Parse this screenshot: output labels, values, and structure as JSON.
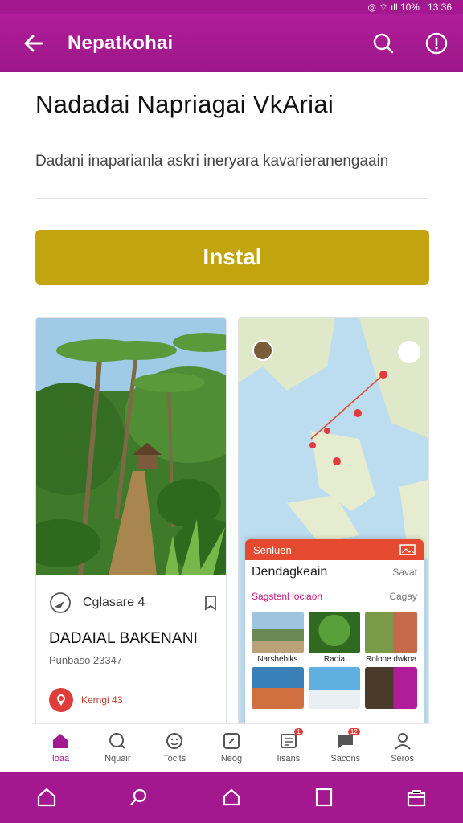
{
  "status_bar": {
    "indicators": "◎ ⌔ ıll 10%",
    "time": "13:36"
  },
  "app_bar": {
    "title": "Nepatkohai",
    "icons": [
      "back-arrow-icon",
      "search-icon",
      "more-info-icon"
    ]
  },
  "app": {
    "title": "Nadadai Napriagai VkAriai",
    "description": "Dadani inaparianla askri ineryara kavarieranengaain",
    "install_label": "Instal"
  },
  "card_left": {
    "info_label": "Cglasare 4",
    "heading": "DADAIAL BAKENANI",
    "sub": "Punbaso 23347",
    "pin_text": "Kerngi 43"
  },
  "card_right": {
    "sheet_header": "Senluen",
    "sheet_title": "Dendagkeain",
    "sheet_meta_1": "Savat",
    "accent_label": "Sagstenl lociaon",
    "sheet_meta_2": "Cagay",
    "thumb_captions": [
      "Narshebiks",
      "Raoia",
      "Rolone dwkoa"
    ]
  },
  "bottom_tabs": [
    {
      "label": "Ioaa",
      "icon": "home-icon",
      "active": true
    },
    {
      "label": "Nquair",
      "icon": "search-icon"
    },
    {
      "label": "Tocits",
      "icon": "face-icon"
    },
    {
      "label": "Neog",
      "icon": "edit-icon"
    },
    {
      "label": "Iisans",
      "icon": "list-icon",
      "badge": "1"
    },
    {
      "label": "Sacons",
      "icon": "chat-icon",
      "badge": "12"
    },
    {
      "label": "Seros",
      "icon": "profile-icon"
    }
  ],
  "nav_bar": {
    "icons": [
      "nav-home-icon",
      "nav-search-icon",
      "nav-house-icon",
      "nav-square-icon",
      "nav-bag-icon"
    ]
  },
  "colors": {
    "brand": "#a3188f",
    "install": "#c2a50e",
    "accent_red": "#e44a2f"
  }
}
